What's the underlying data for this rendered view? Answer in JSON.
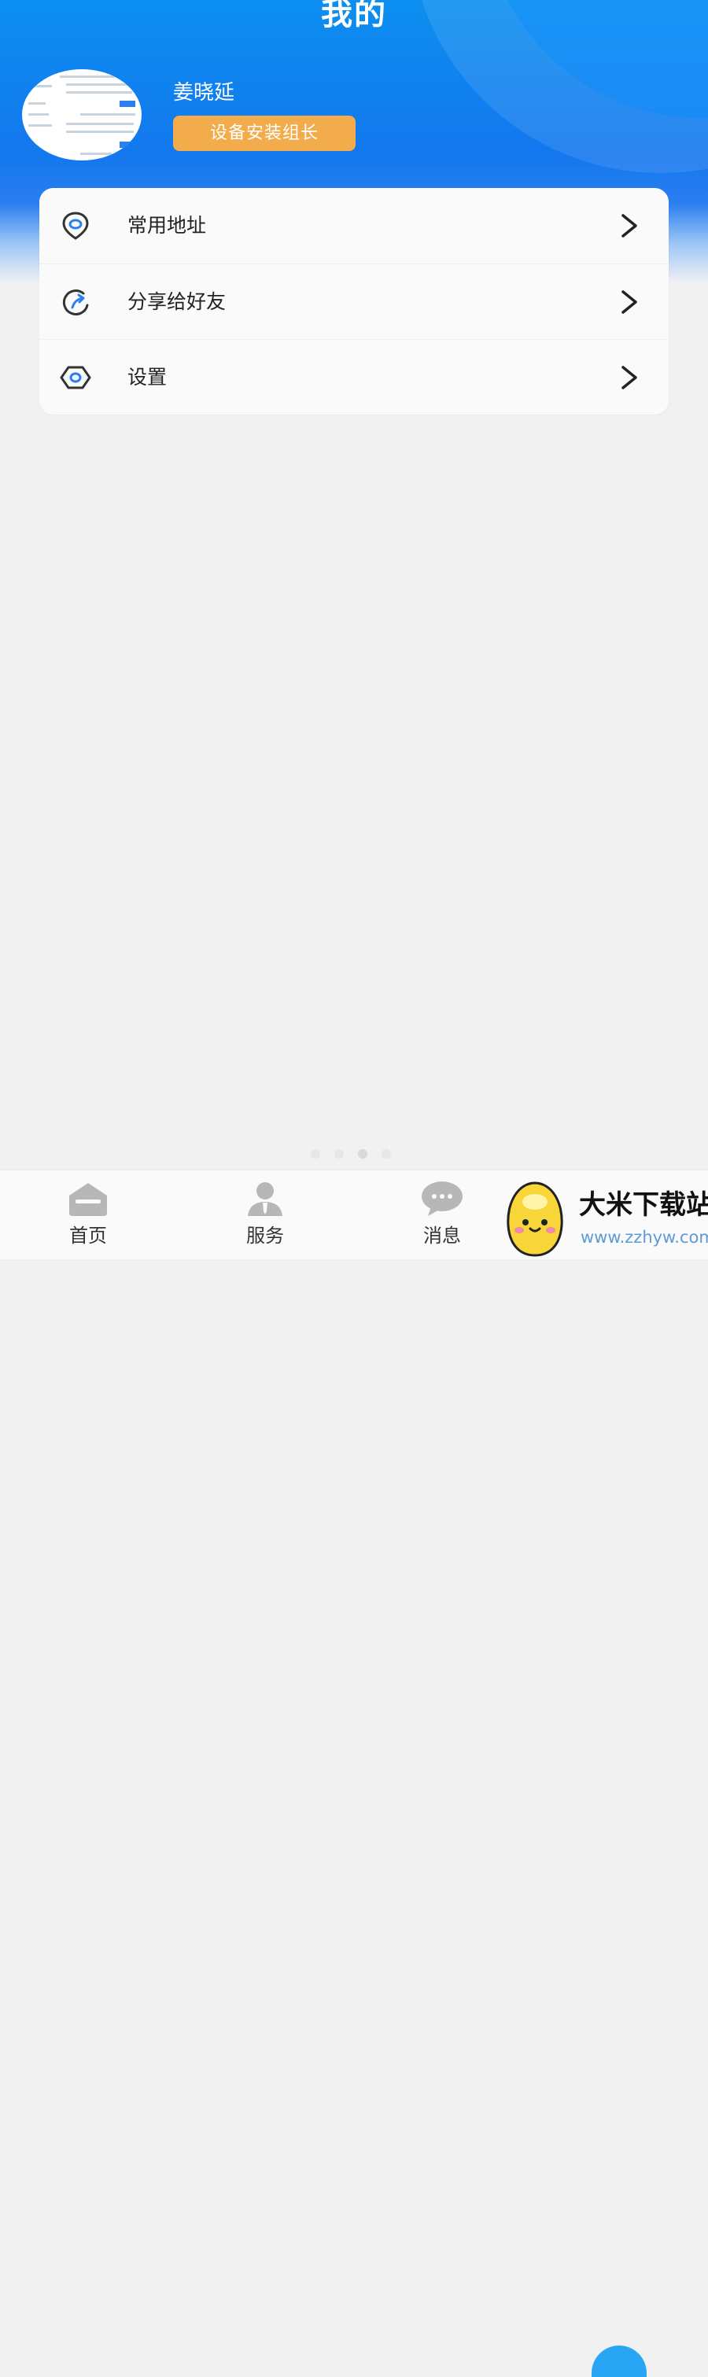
{
  "header": {
    "title": "我的"
  },
  "profile": {
    "name": "姜晓延",
    "role": "设备安装组长"
  },
  "menu": {
    "items": [
      {
        "label": "常用地址",
        "icon": "location-pin-icon"
      },
      {
        "label": "分享给好友",
        "icon": "share-icon"
      },
      {
        "label": "设置",
        "icon": "settings-icon"
      }
    ]
  },
  "tabbar": {
    "items": [
      {
        "label": "首页",
        "icon": "home-icon"
      },
      {
        "label": "服务",
        "icon": "service-person-icon"
      },
      {
        "label": "消息",
        "icon": "message-icon"
      }
    ]
  },
  "watermark": {
    "title": "大米下载站",
    "url": "www.zzhyw.com"
  },
  "colors": {
    "header_blue": "#1377ee",
    "badge_orange": "#f3ac4c",
    "icon_blue": "#2b7ff0",
    "icon_gray": "#b7b7b7"
  }
}
